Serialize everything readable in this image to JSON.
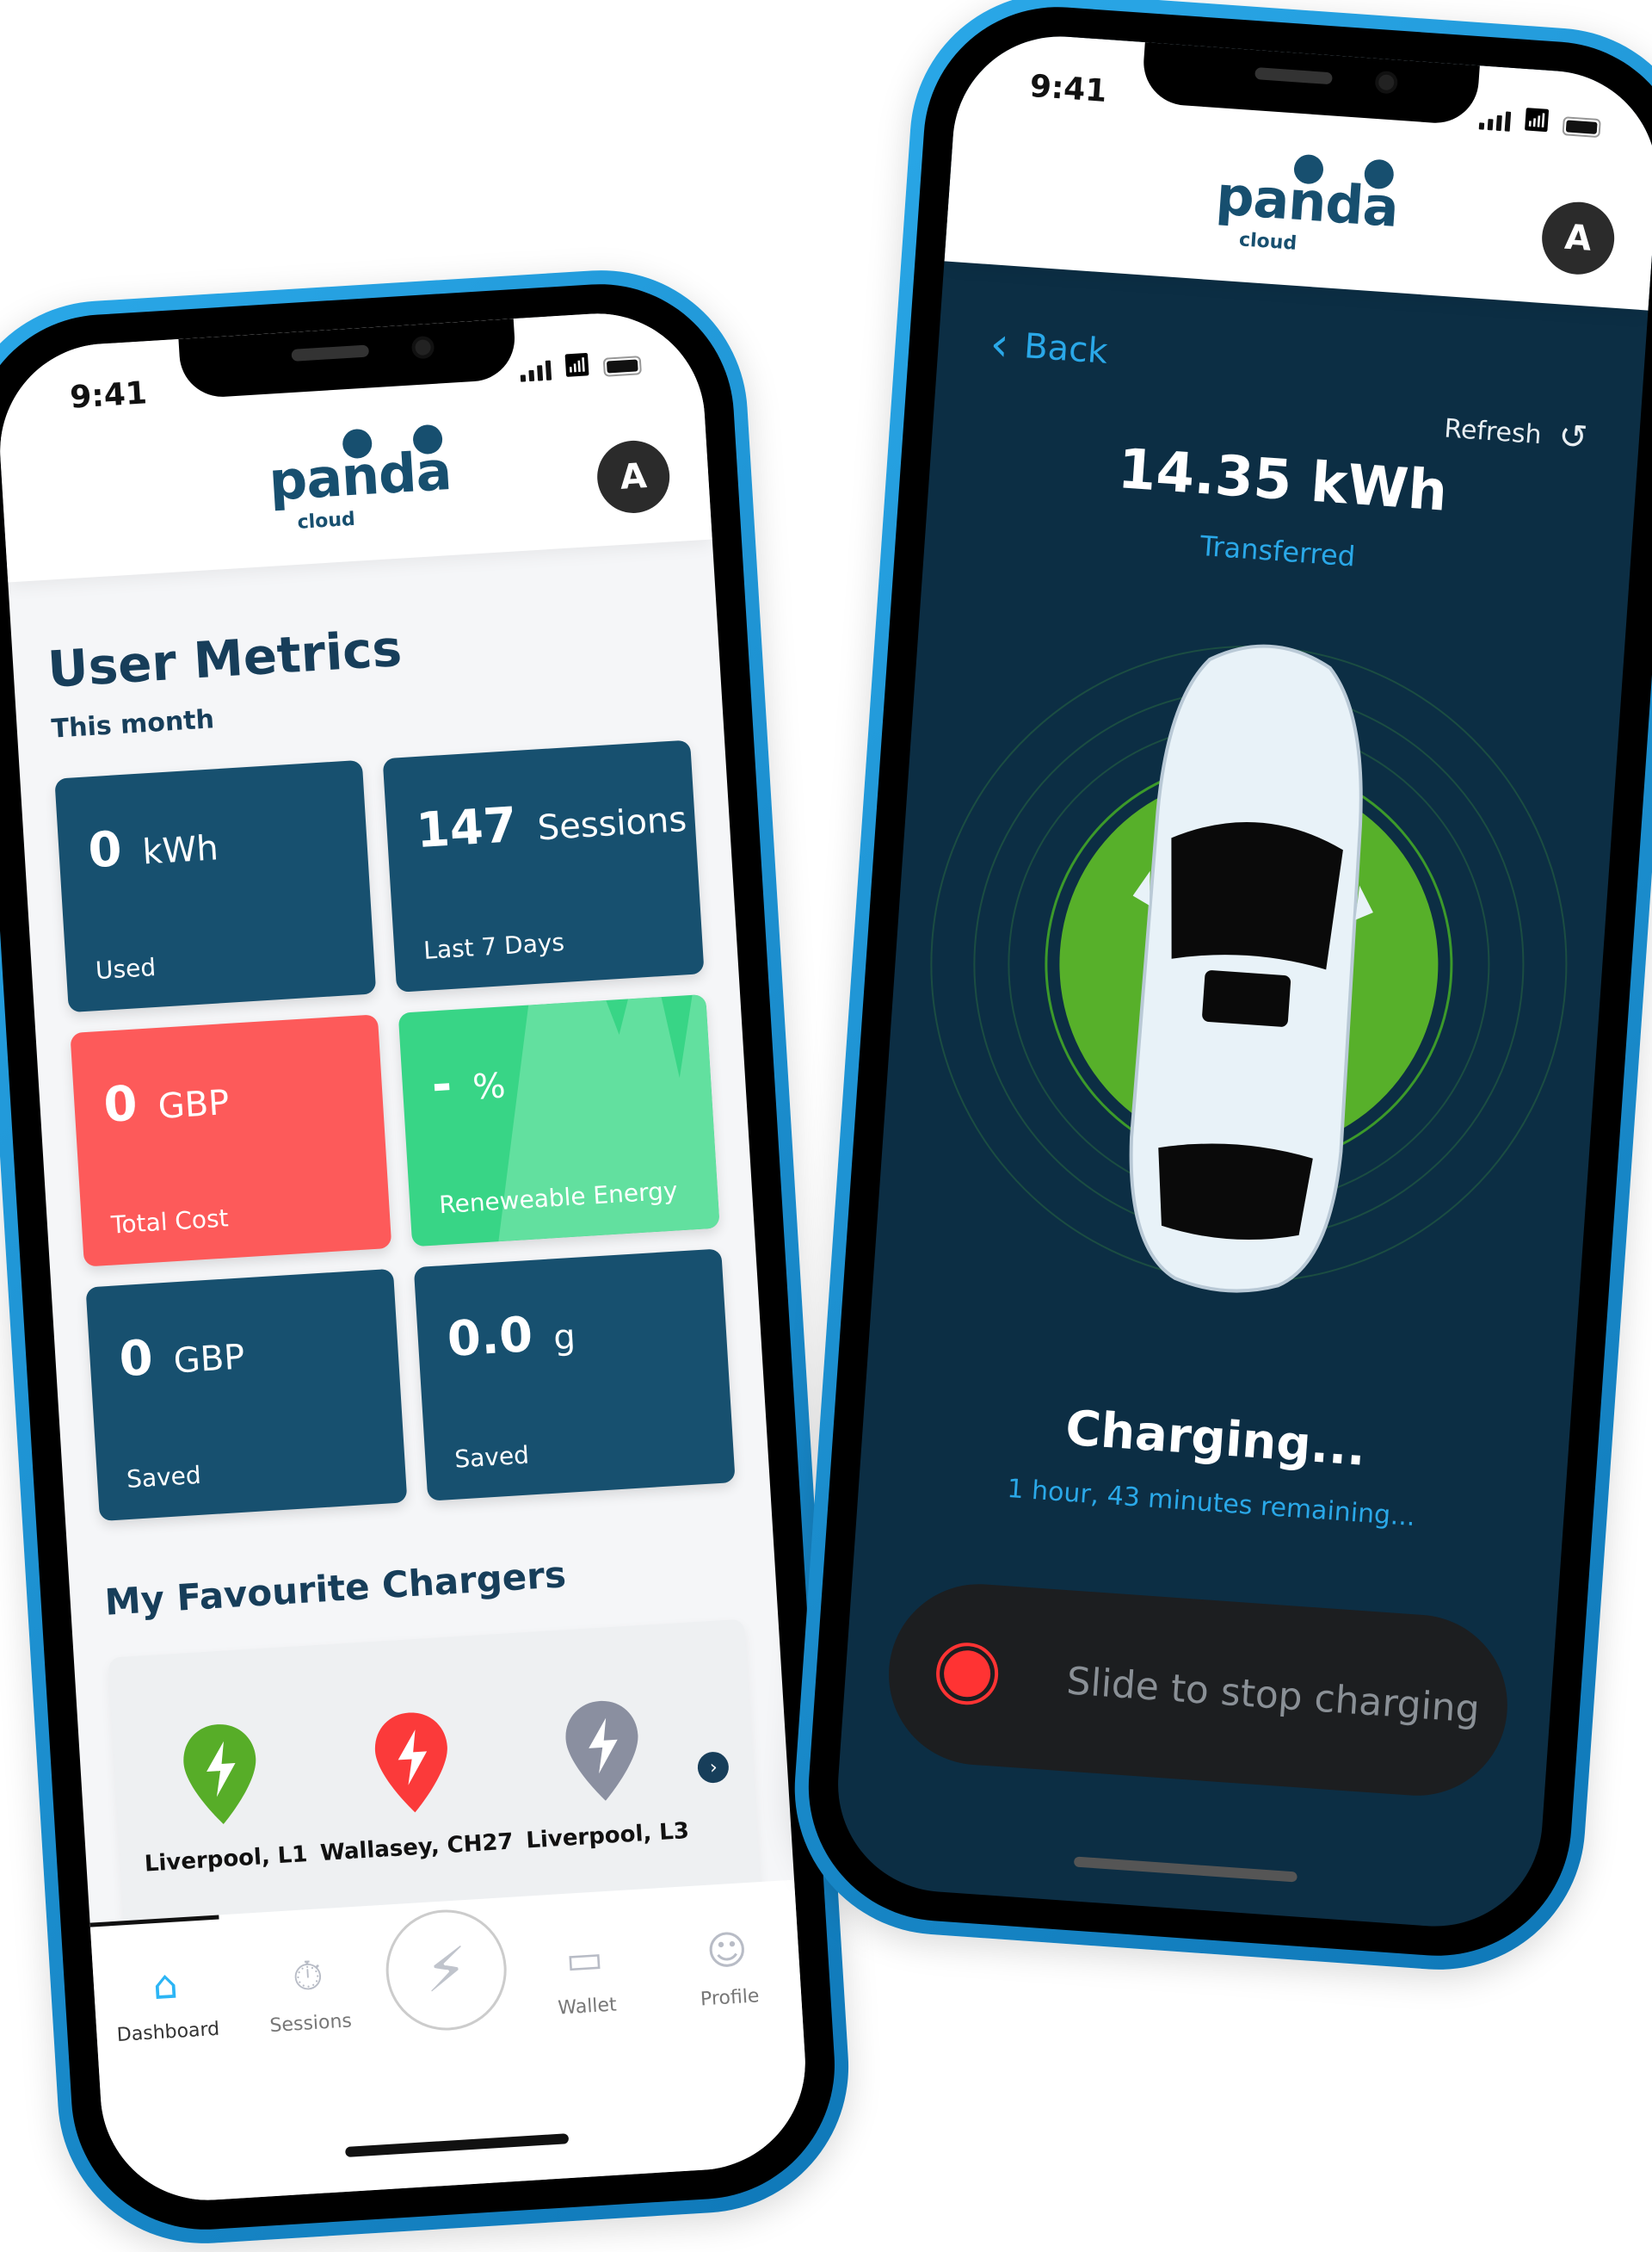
{
  "status_time": "9:41",
  "logo": {
    "word": "panda",
    "sub": "cloud"
  },
  "avatar_letter": "A",
  "dashboard": {
    "title": "User Metrics",
    "subtitle": "This month",
    "metrics": [
      {
        "value": "0",
        "unit": "kWh",
        "label": "Used",
        "color": "#17506f"
      },
      {
        "value": "147",
        "unit": "Sessions",
        "label": "Last 7 Days",
        "color": "#17506f"
      },
      {
        "value": "0",
        "unit": "GBP",
        "label": "Total Cost",
        "color": "#fd5a5a"
      },
      {
        "value": "-",
        "unit": "%",
        "label": "Reneweable Energy",
        "color": "#38d586"
      },
      {
        "value": "0",
        "unit": "GBP",
        "label": "Saved",
        "color": "#17506f"
      },
      {
        "value": "0.0",
        "unit": "g",
        "label": "Saved",
        "color": "#17506f"
      }
    ],
    "favourites_title": "My Favourite Chargers",
    "chargers": [
      {
        "name": "Liverpool, L1",
        "color": "#57ad28"
      },
      {
        "name": "Wallasey, CH27",
        "color": "#fb3a3a"
      },
      {
        "name": "Liverpool, L3",
        "color": "#8a8fa0"
      }
    ],
    "nav": [
      {
        "label": "Dashboard",
        "icon": "home-icon"
      },
      {
        "label": "Sessions",
        "icon": "stopwatch-icon"
      },
      {
        "label": "",
        "icon": "lightning-icon"
      },
      {
        "label": "Wallet",
        "icon": "wallet-icon"
      },
      {
        "label": "Profile",
        "icon": "person-icon"
      }
    ]
  },
  "charging": {
    "back": "Back",
    "refresh": "Refresh",
    "energy": "14.35 kWh",
    "energy_label": "Transferred",
    "status": "Charging...",
    "remaining": "1 hour, 43 minutes remaining...",
    "slider_label": "Slide to stop charging"
  }
}
